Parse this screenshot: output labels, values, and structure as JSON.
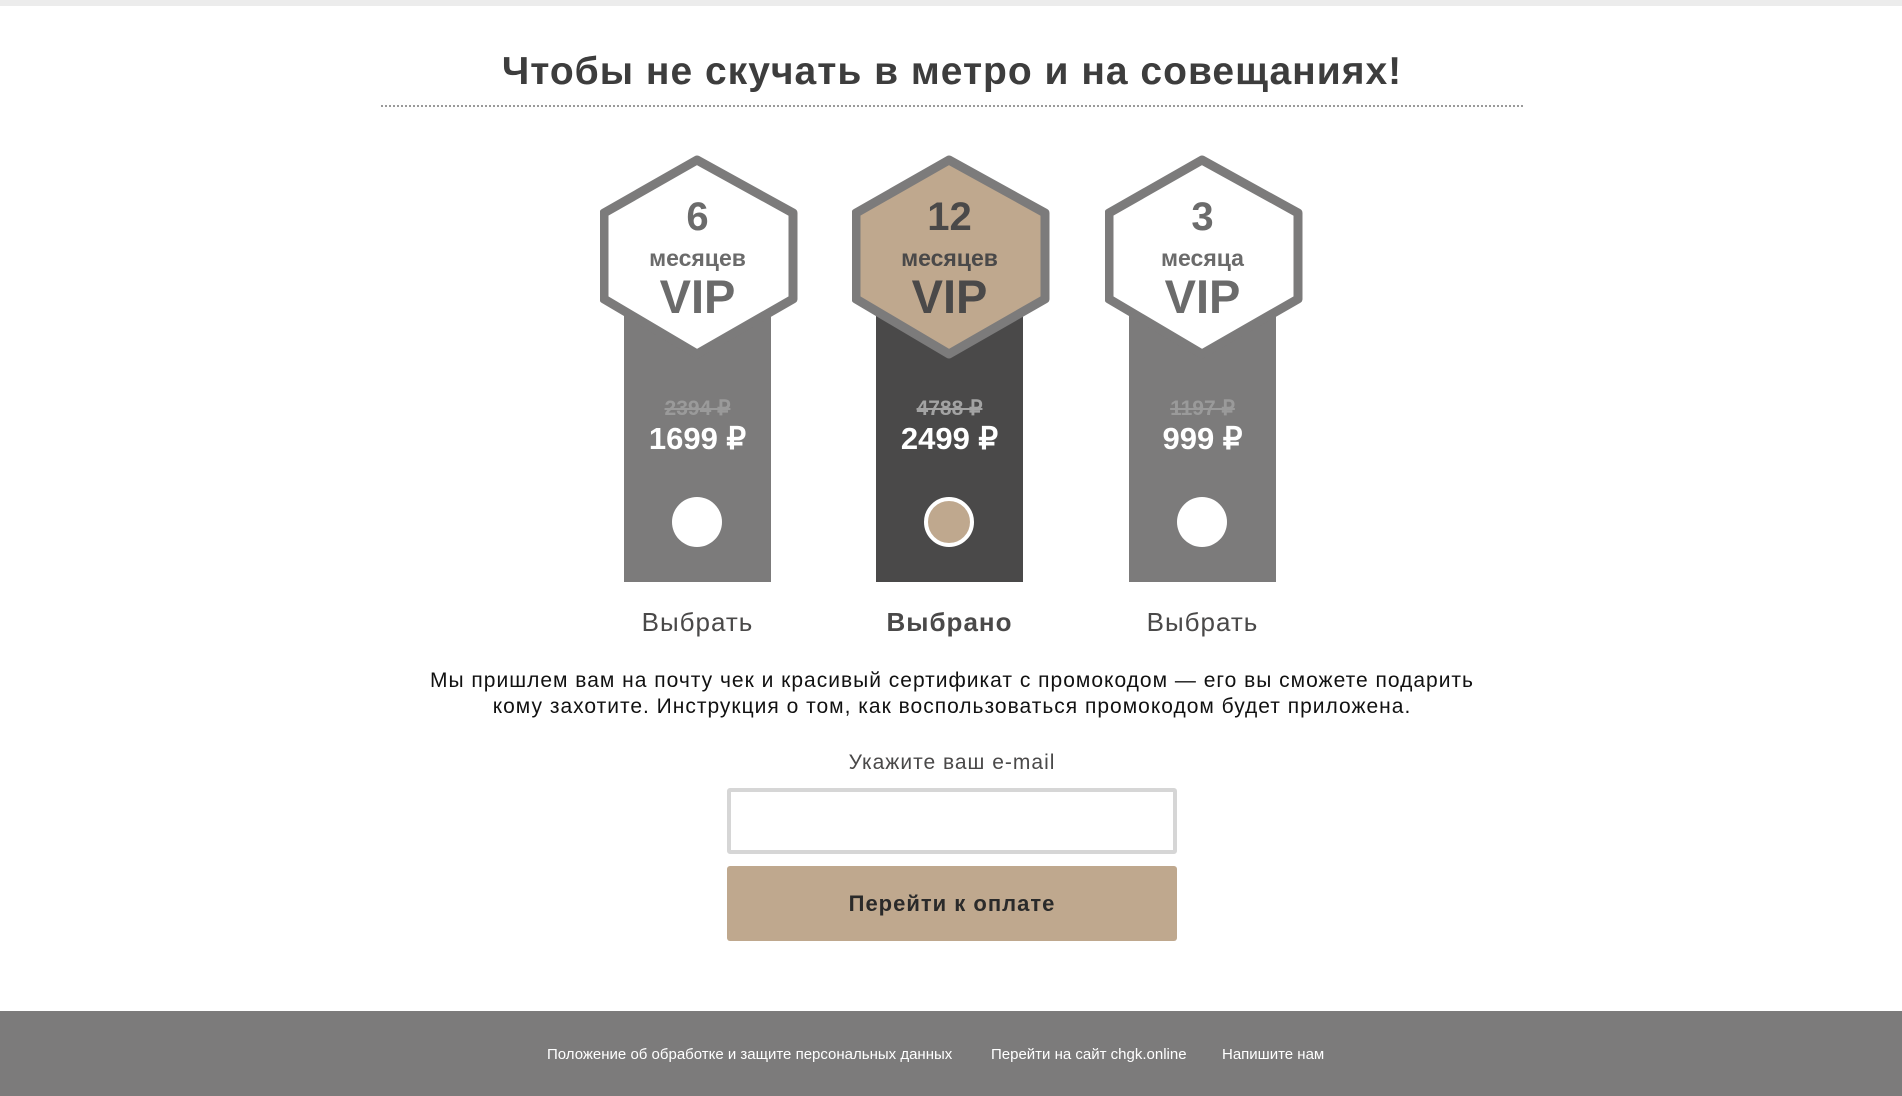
{
  "header": {
    "title": "Чтобы не скучать в метро и на совещаниях!"
  },
  "colors": {
    "accent": "#bfa88e",
    "strip": "#7c7b7b",
    "strip_selected": "#4a4949",
    "footer": "#7c7b7b"
  },
  "plans": [
    {
      "months": "6",
      "unit": "месяцев",
      "tier": "VIP",
      "old_price": "2394 ₽",
      "price": "1699 ₽",
      "action": "Выбрать",
      "selected": false
    },
    {
      "months": "12",
      "unit": "месяцев",
      "tier": "VIP",
      "old_price": "4788 ₽",
      "price": "2499 ₽",
      "action": "Выбрано",
      "selected": true
    },
    {
      "months": "3",
      "unit": "месяца",
      "tier": "VIP",
      "old_price": "1197 ₽",
      "price": "999 ₽",
      "action": "Выбрать",
      "selected": false
    }
  ],
  "description": {
    "line1": "Мы пришлем вам на почту чек и красивый сертификат с промокодом — его вы сможете подарить",
    "line2": "кому захотите. Инструкция о том, как воспользоваться промокодом будет приложена."
  },
  "form": {
    "email_label": "Укажите ваш e-mail",
    "email_value": "",
    "submit_label": "Перейти к оплате"
  },
  "footer": {
    "links": [
      "Положение об обработке и защите персональных данных",
      "Перейти на сайт chgk.online",
      "Напишите нам"
    ]
  }
}
